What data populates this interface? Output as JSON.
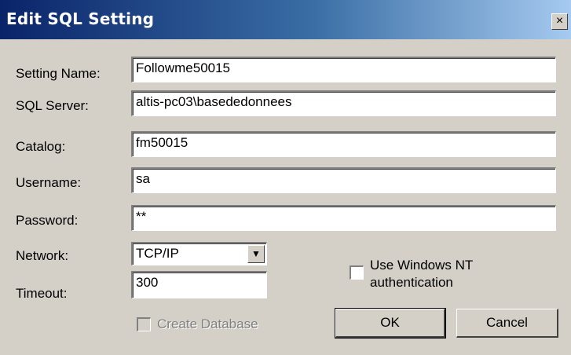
{
  "window": {
    "title": "Edit SQL Setting",
    "close_glyph": "×"
  },
  "form": {
    "setting_name": {
      "label": "Setting Name:",
      "value": "Followme50015"
    },
    "sql_server": {
      "label": "SQL Server:",
      "value": "altis-pc03\\basededonnees"
    },
    "catalog": {
      "label": "Catalog:",
      "value": "fm50015"
    },
    "username": {
      "label": "Username:",
      "value": "sa"
    },
    "password": {
      "label": "Password:",
      "value": "**"
    },
    "network": {
      "label": "Network:",
      "value": "TCP/IP"
    },
    "timeout": {
      "label": "Timeout:",
      "value": "300"
    },
    "use_nt_auth": {
      "label_line1": "Use Windows NT",
      "label_line2": "authentication",
      "checked": false
    },
    "create_database": {
      "label": "Create Database",
      "checked": false,
      "enabled": false
    }
  },
  "buttons": {
    "ok": "OK",
    "cancel": "Cancel"
  },
  "icons": {
    "dropdown": "chevron-down-icon",
    "close": "close-icon"
  }
}
